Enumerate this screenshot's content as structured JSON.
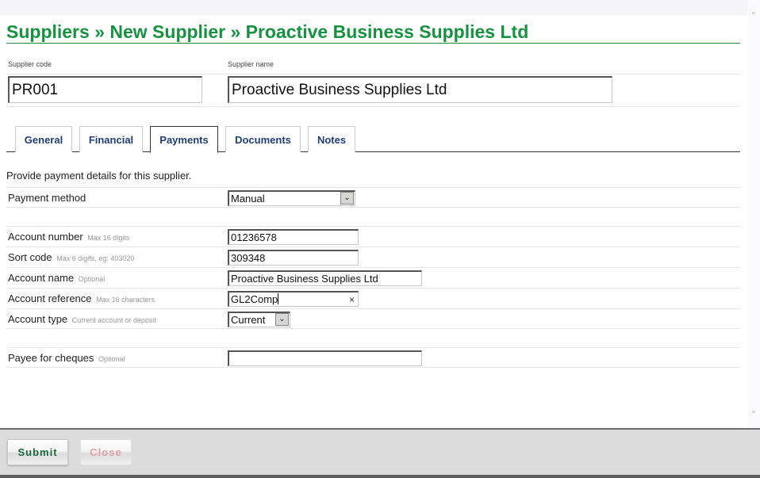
{
  "header": {
    "title": "Suppliers » New Supplier » Proactive Business Supplies Ltd",
    "title_color": "#159340"
  },
  "supplier": {
    "code_label": "Supplier code",
    "code_value": "PR001",
    "name_label": "Supplier name",
    "name_value": "Proactive Business Supplies Ltd"
  },
  "tabs": [
    {
      "label": "General",
      "active": false
    },
    {
      "label": "Financial",
      "active": false
    },
    {
      "label": "Payments",
      "active": true
    },
    {
      "label": "Documents",
      "active": false
    },
    {
      "label": "Notes",
      "active": false
    }
  ],
  "payments": {
    "intro": "Provide payment details for this supplier.",
    "payment_method": {
      "label": "Payment method",
      "value": "Manual"
    },
    "account_number": {
      "label": "Account number",
      "hint": "Max 16 digits",
      "value": "01236578"
    },
    "sort_code": {
      "label": "Sort code",
      "hint": "Max 6 digits, eg: 403020",
      "value": "309348"
    },
    "account_name": {
      "label": "Account name",
      "hint": "Optional",
      "value": "Proactive Business Supplies Ltd"
    },
    "account_reference": {
      "label": "Account reference",
      "hint": "Max 16 characters",
      "value": "GL2Comp",
      "clear_icon": "×"
    },
    "account_type": {
      "label": "Account type",
      "hint": "Current account or deposit",
      "value": "Current"
    },
    "payee": {
      "label": "Payee for cheques",
      "hint": "Optional",
      "value": ""
    }
  },
  "footer": {
    "submit_label": "Submit",
    "close_label": "Close"
  },
  "icons": {
    "dropdown": "⌄",
    "scroll_up": "^",
    "scroll_down": "⌄"
  }
}
